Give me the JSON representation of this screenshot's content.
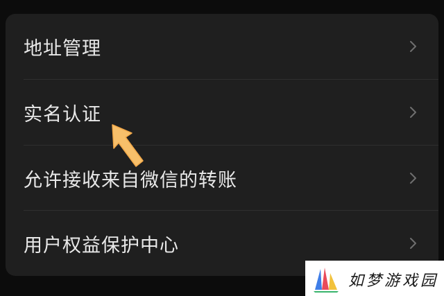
{
  "menu": {
    "items": [
      {
        "label": "地址管理",
        "chevron_icon": "chevron-right-icon"
      },
      {
        "label": "实名认证",
        "chevron_icon": "chevron-right-icon"
      },
      {
        "label": "允许接收来自微信的转账",
        "chevron_icon": "chevron-right-icon"
      },
      {
        "label": "用户权益保护中心",
        "chevron_icon": "chevron-right-icon"
      }
    ]
  },
  "annotation": {
    "icon": "pointer-arrow-icon",
    "color": "#f7bf6a"
  },
  "watermark": {
    "text": "如梦游戏园",
    "logo_icon": "sail-logo-icon"
  },
  "colors": {
    "background": "#0c0c0c",
    "card": "#1f1f1f",
    "text": "#e9e9e9",
    "chevron": "#6f6f6f",
    "divider": "#2f2f2f"
  }
}
